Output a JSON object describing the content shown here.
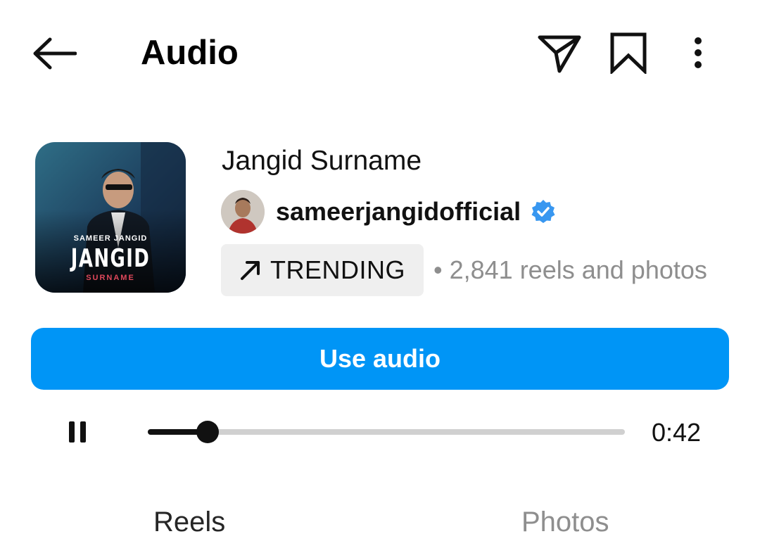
{
  "header": {
    "title": "Audio",
    "icons": [
      "back-arrow-icon",
      "send-icon",
      "bookmark-icon",
      "more-vertical-icon"
    ]
  },
  "audio": {
    "cover": {
      "artist_text": "SAMEER JANGID",
      "title_text": "JANGID",
      "subtitle_text": "SURNAME"
    },
    "title": "Jangid Surname",
    "artist": "sameerjangidofficial",
    "verified": true,
    "trending_label": "TRENDING",
    "count_text": "• 2,841 reels and photos"
  },
  "actions": {
    "use_audio_label": "Use audio"
  },
  "player": {
    "state": "playing",
    "progress_fraction": 0.125,
    "time": "0:42"
  },
  "tabs": [
    {
      "label": "Reels",
      "active": true
    },
    {
      "label": "Photos",
      "active": false
    }
  ],
  "colors": {
    "accent": "#0095f6",
    "verified": "#3897f0",
    "muted_text": "#8e8e8e",
    "badge_bg": "#efefef"
  }
}
